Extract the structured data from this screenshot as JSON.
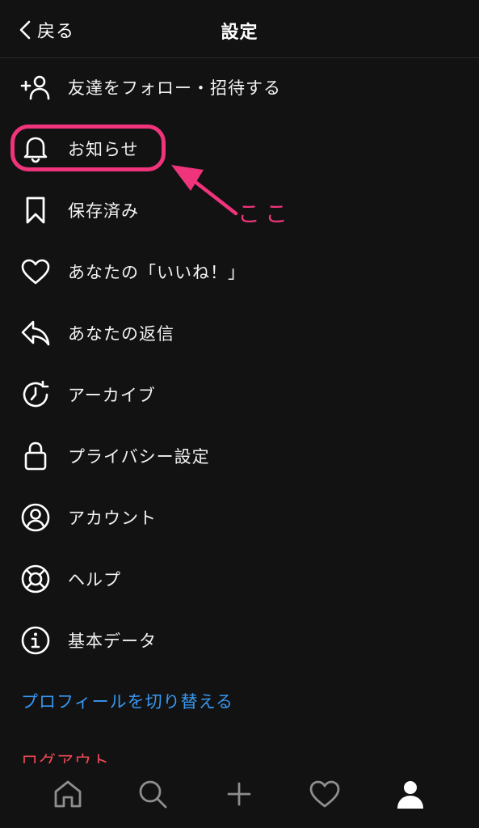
{
  "header": {
    "back_label": "戻る",
    "title": "設定"
  },
  "menu": {
    "items": [
      {
        "label": "友達をフォロー・招待する",
        "icon": "add-person-icon"
      },
      {
        "label": "お知らせ",
        "icon": "bell-icon"
      },
      {
        "label": "保存済み",
        "icon": "bookmark-icon"
      },
      {
        "label": "あなたの「いいね！」",
        "icon": "heart-icon"
      },
      {
        "label": "あなたの返信",
        "icon": "reply-icon"
      },
      {
        "label": "アーカイブ",
        "icon": "archive-clock-icon"
      },
      {
        "label": "プライバシー設定",
        "icon": "lock-icon"
      },
      {
        "label": "アカウント",
        "icon": "account-circle-icon"
      },
      {
        "label": "ヘルプ",
        "icon": "lifebuoy-icon"
      },
      {
        "label": "基本データ",
        "icon": "info-icon"
      }
    ],
    "switch_profile_label": "プロフィールを切り替える",
    "logout_label": "ログアウト"
  },
  "annotation": {
    "text": "ここ",
    "color": "#f0347c"
  },
  "tabbar": {
    "tabs": [
      "home-icon",
      "search-icon",
      "plus-icon",
      "heart-icon",
      "profile-icon"
    ]
  },
  "colors": {
    "background": "#121212",
    "link_blue": "#3897f0",
    "logout_red": "#ed4956"
  }
}
